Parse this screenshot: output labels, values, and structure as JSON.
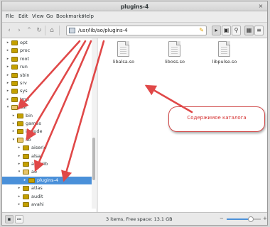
{
  "window": {
    "title": "plugins-4",
    "close_glyph": "×"
  },
  "menu": [
    {
      "label": "File"
    },
    {
      "label": "Edit"
    },
    {
      "label": "View"
    },
    {
      "label": "Go"
    },
    {
      "label": "Bookmarks"
    },
    {
      "label": "Help"
    }
  ],
  "toolbar": {
    "location": "/usr/lib/ao/plugins-4",
    "location_icon": "drive-icon",
    "clear_icon": "clear-location-icon"
  },
  "sidebar": {
    "rows": [
      {
        "label": "opt",
        "indent": 0,
        "expanded": false,
        "selected": false
      },
      {
        "label": "proc",
        "indent": 0,
        "expanded": false,
        "selected": false
      },
      {
        "label": "root",
        "indent": 0,
        "expanded": false,
        "selected": false
      },
      {
        "label": "run",
        "indent": 0,
        "expanded": false,
        "selected": false
      },
      {
        "label": "sbin",
        "indent": 0,
        "expanded": false,
        "selected": false
      },
      {
        "label": "srv",
        "indent": 0,
        "expanded": false,
        "selected": false
      },
      {
        "label": "sys",
        "indent": 0,
        "expanded": false,
        "selected": false
      },
      {
        "label": "tmp",
        "indent": 0,
        "expanded": false,
        "selected": false
      },
      {
        "label": "usr",
        "indent": 0,
        "expanded": true,
        "selected": false
      },
      {
        "label": "bin",
        "indent": 1,
        "expanded": false,
        "selected": false
      },
      {
        "label": "games",
        "indent": 1,
        "expanded": false,
        "selected": false
      },
      {
        "label": "include",
        "indent": 1,
        "expanded": false,
        "selected": false
      },
      {
        "label": "lib",
        "indent": 1,
        "expanded": true,
        "selected": false
      },
      {
        "label": "aiserio",
        "indent": 2,
        "expanded": false,
        "selected": false
      },
      {
        "label": "alsa",
        "indent": 2,
        "expanded": false,
        "selected": false
      },
      {
        "label": "alsa-lib",
        "indent": 2,
        "expanded": false,
        "selected": false
      },
      {
        "label": "ao",
        "indent": 2,
        "expanded": true,
        "selected": false
      },
      {
        "label": "plugins-4",
        "indent": 3,
        "expanded": false,
        "selected": true
      },
      {
        "label": "atlas",
        "indent": 2,
        "expanded": false,
        "selected": false
      },
      {
        "label": "audit",
        "indent": 2,
        "expanded": false,
        "selected": false
      },
      {
        "label": "avahi",
        "indent": 2,
        "expanded": false,
        "selected": false
      }
    ]
  },
  "files": [
    {
      "name": "libalsa.so",
      "icon": "shared-library-icon"
    },
    {
      "name": "liboss.so",
      "icon": "shared-library-icon"
    },
    {
      "name": "libpulse.so",
      "icon": "shared-library-icon"
    }
  ],
  "callout": {
    "text": "Содержимое каталога"
  },
  "status": {
    "text": "3 items, Free space: 13.1 GB",
    "zoom_level": 0.7
  },
  "colors": {
    "annotation": "#e04848",
    "selection": "#4a90d9"
  }
}
